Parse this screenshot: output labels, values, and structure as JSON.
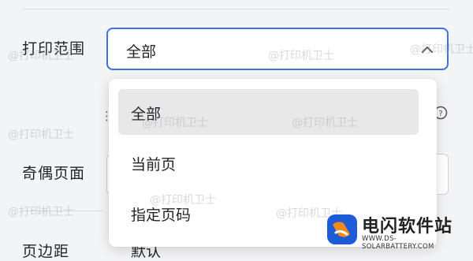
{
  "form": {
    "print_range_label": "打印范围",
    "odd_even_label": "奇偶页面",
    "partial_label": "页边距",
    "selected_value": "全部",
    "partial_value": "默认"
  },
  "dropdown": {
    "options": [
      {
        "label": "全部",
        "selected": true
      },
      {
        "label": "当前页",
        "selected": false
      },
      {
        "label": "指定页码",
        "selected": false
      }
    ]
  },
  "watermark": {
    "text": "@打印机卫士"
  },
  "brand": {
    "name": "电闪软件站",
    "domain": "WWW.DS-SOLARBATTERY.COM",
    "colors": {
      "blue": "#1e5bd6",
      "orange": "#f28a1c"
    }
  },
  "icons": {
    "chevron": "chevron-up-icon",
    "help": "help-circle-icon"
  },
  "colors": {
    "accent_border": "#3f6fe3",
    "selected_option_bg": "#e8e8e8"
  }
}
